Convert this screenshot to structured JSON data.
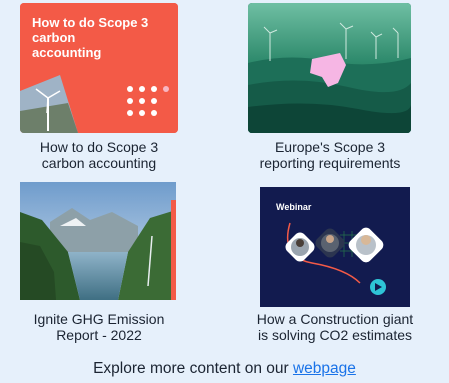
{
  "cards": [
    {
      "thumb_title": [
        "How to do Scope 3",
        "carbon",
        "accounting"
      ],
      "caption": [
        "How to do Scope 3",
        "carbon accounting"
      ]
    },
    {
      "caption": [
        "Europe's Scope 3",
        "reporting requirements"
      ]
    },
    {
      "caption": [
        "Ignite GHG Emission",
        "Report - 2022"
      ]
    },
    {
      "thumb_label": "Webinar",
      "caption": [
        "How a Construction giant",
        "is solving CO2 estimates"
      ]
    }
  ],
  "footer": {
    "text": "Explore more content on our ",
    "link_label": "webpage"
  },
  "colors": {
    "background": "#e6f0fb",
    "link": "#1a73e8",
    "coral": "#f35a47",
    "teal": "#11594a",
    "navy": "#121b4f",
    "accent_cyan": "#2ec4d6"
  }
}
